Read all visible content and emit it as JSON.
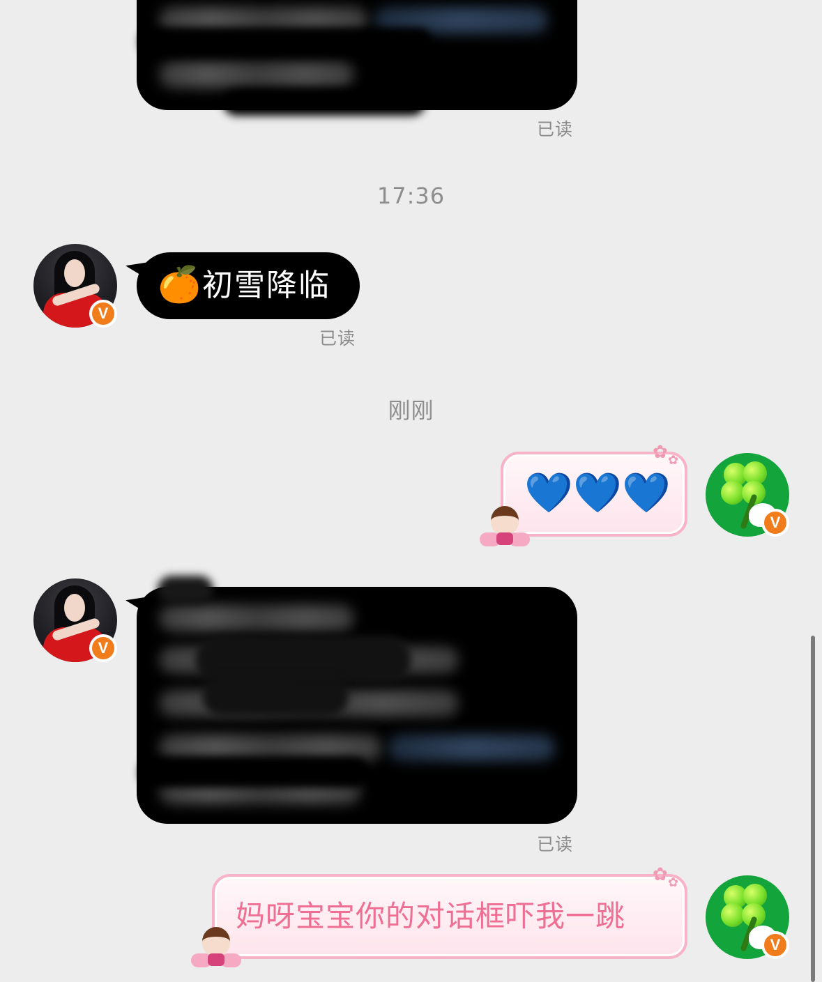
{
  "messages": {
    "m1": {
      "read_label": "已读"
    },
    "time_divider_1": "17:36",
    "m2": {
      "emoji": "🍊",
      "text": "初雪降临",
      "read_label": "已读"
    },
    "time_divider_2": "刚刚",
    "m3": {
      "hearts": [
        "💙",
        "💙",
        "💙"
      ]
    },
    "m4": {
      "read_label": "已读"
    },
    "m5": {
      "text": "妈呀宝宝你的对话框吓我一跳"
    }
  },
  "badge_label": "V",
  "icons": {
    "flower": "✿",
    "avatar_other": "girl-in-red-dress-avatar",
    "avatar_self": "four-leaf-clover-avatar",
    "verified": "verified-badge-icon",
    "sticker": "anime-boy-sticker-icon"
  },
  "colors": {
    "background": "#ededed",
    "bubble_black": "#000000",
    "bubble_pink_border": "#f8b3c8",
    "pink_text": "#ee6f93",
    "badge": "#f07c1c",
    "heart_blue": "#5cc8f5"
  }
}
